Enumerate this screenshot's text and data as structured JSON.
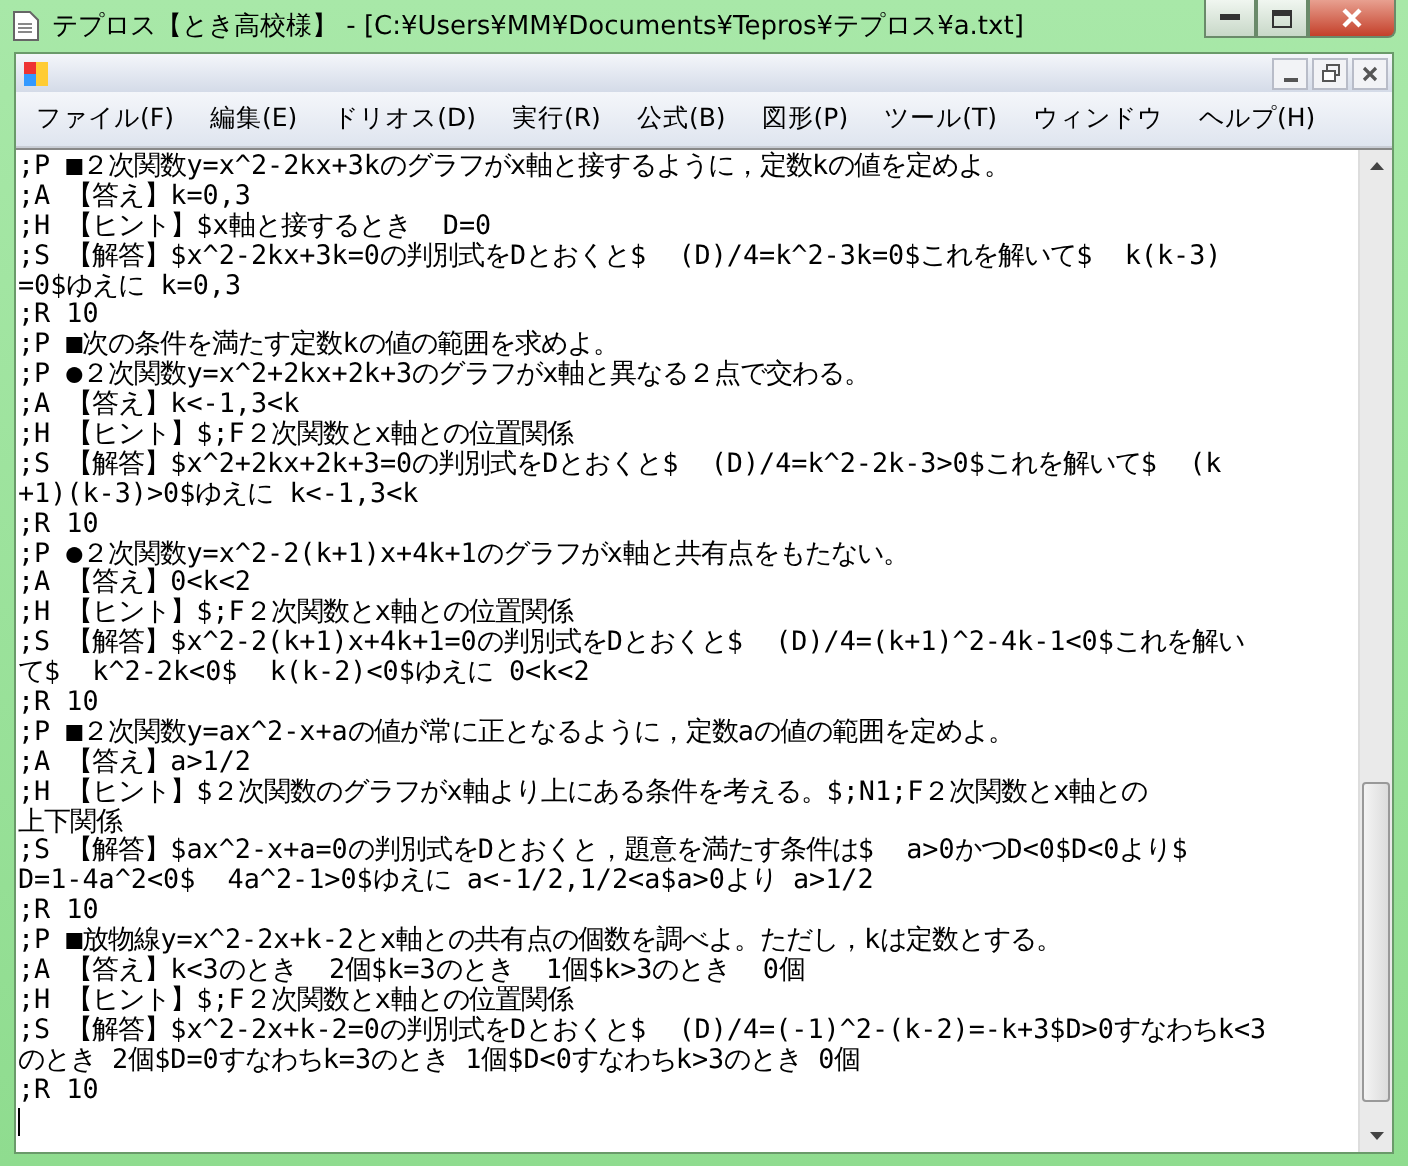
{
  "window": {
    "title": "テプロス【とき高校様】 - [C:¥Users¥MM¥Documents¥Tepros¥テプロス¥a.txt]"
  },
  "menu": [
    "ファイル(F)",
    "編集(E)",
    "ドリオス(D)",
    "実行(R)",
    "公式(B)",
    "図形(P)",
    "ツール(T)",
    "ウィンドウ",
    "ヘルプ(H)"
  ],
  "editor": {
    "lines": [
      ";P ■２次関数y=x^2-2kx+3kのグラフがx軸と接するように，定数kの値を定めよ。",
      ";A 【答え】k=0,3",
      ";H 【ヒント】$x軸と接するとき  D=0",
      ";S 【解答】$x^2-2kx+3k=0の判別式をDとおくと$  (D)/4=k^2-3k=0$これを解いて$  k(k-3)",
      "=0$ゆえに k=0,3",
      ";R 10",
      ";P ■次の条件を満たす定数kの値の範囲を求めよ。",
      ";P ●２次関数y=x^2+2kx+2k+3のグラフがx軸と異なる２点で交わる。",
      ";A 【答え】k<-1,3<k",
      ";H 【ヒント】$;F２次関数とx軸との位置関係",
      ";S 【解答】$x^2+2kx+2k+3=0の判別式をDとおくと$  (D)/4=k^2-2k-3>0$これを解いて$  (k",
      "+1)(k-3)>0$ゆえに k<-1,3<k",
      ";R 10",
      ";P ●２次関数y=x^2-2(k+1)x+4k+1のグラフがx軸と共有点をもたない。",
      ";A 【答え】0<k<2",
      ";H 【ヒント】$;F２次関数とx軸との位置関係",
      ";S 【解答】$x^2-2(k+1)x+4k+1=0の判別式をDとおくと$  (D)/4=(k+1)^2-4k-1<0$これを解い",
      "て$  k^2-2k<0$  k(k-2)<0$ゆえに 0<k<2",
      ";R 10",
      ";P ■２次関数y=ax^2-x+aの値が常に正となるように，定数aの値の範囲を定めよ。",
      ";A 【答え】a>1/2",
      ";H 【ヒント】$２次関数のグラフがx軸より上にある条件を考える。$;N1;F２次関数とx軸との",
      "上下関係",
      ";S 【解答】$ax^2-x+a=0の判別式をDとおくと，題意を満たす条件は$  a>0かつD<0$D<0より$",
      "D=1-4a^2<0$  4a^2-1>0$ゆえに a<-1/2,1/2<a$a>0より a>1/2",
      ";R 10",
      ";P ■放物線y=x^2-2x+k-2とx軸との共有点の個数を調べよ。ただし，kは定数とする。",
      ";A 【答え】k<3のとき  2個$k=3のとき  1個$k>3のとき  0個",
      ";H 【ヒント】$;F２次関数とx軸との位置関係",
      ";S 【解答】$x^2-2x+k-2=0の判別式をDとおくと$  (D)/4=(-1)^2-(k-2)=-k+3$D>0すなわちk<3",
      "のとき 2個$D=0すなわちk=3のとき 1個$D<0すなわちk>3のとき 0個",
      ";R 10"
    ]
  }
}
